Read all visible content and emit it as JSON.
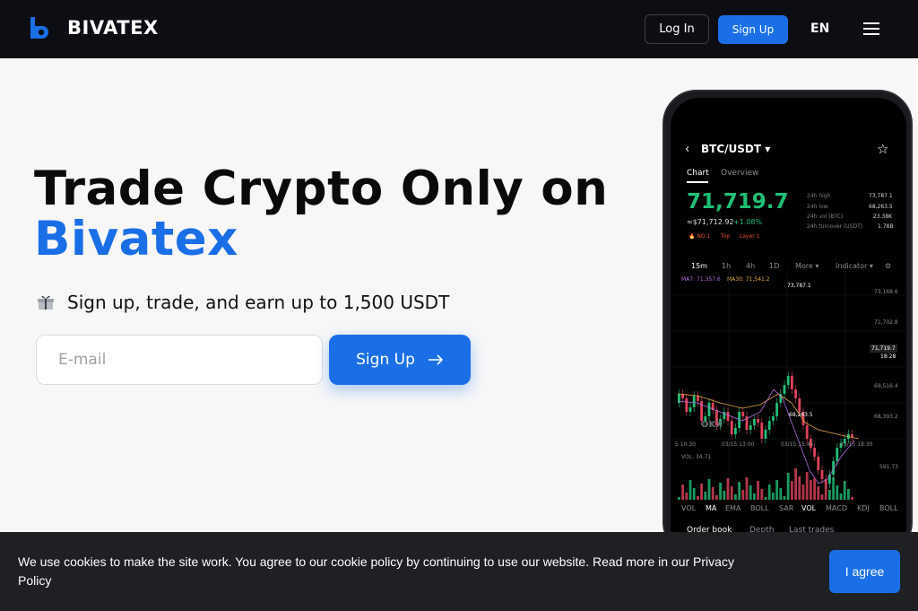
{
  "header": {
    "brand": "BIVATEX",
    "login_label": "Log In",
    "signup_label": "Sign Up",
    "language": "EN",
    "icons": [
      "bivatex-logo-icon",
      "hamburger-menu-icon"
    ]
  },
  "hero": {
    "title_line1": "Trade Crypto Only on",
    "title_line2": "Bivatex",
    "subline": "Sign up, trade, and earn up to 1,500 USDT",
    "email_placeholder": "E-mail",
    "signup_label": "Sign Up",
    "icons": [
      "gift-icon",
      "arrow-right-icon"
    ]
  },
  "phone": {
    "pair": "BTC/USDT",
    "tabs": [
      "Chart",
      "Overview"
    ],
    "price": "71,719.7",
    "sub_price": "≈$71,712.92",
    "change": "+1.08%",
    "stats": [
      {
        "label": "24h high",
        "value": "73,787.1"
      },
      {
        "label": "24h low",
        "value": "68,263.5"
      },
      {
        "label": "24h vol (BTC)",
        "value": "23.38K"
      },
      {
        "label": "24h turnover (USDT)",
        "value": "1.78B"
      }
    ],
    "tags": [
      "NO.1",
      "Top",
      "Layer 1"
    ],
    "timeframes": [
      "15m",
      "1h",
      "4h",
      "1D",
      "More ▾",
      "Indicator ▾"
    ],
    "ma7": "MA7: 71,357.6",
    "ma30": "MA30: 71,541.2",
    "high_label": "73,787.1",
    "low_label": "68,263.5",
    "right_axis": [
      "73,168.6",
      "71,702.8",
      "69,516.4",
      "68,393.2"
    ],
    "current_tag": "71,719.7",
    "current_time": "18:28",
    "dates": [
      "5 10:30",
      "03/15 13:00",
      "03/15 15:45",
      "03/15 18:30"
    ],
    "vol_label": "VOL: 34.71",
    "vol_axis": "591.73",
    "indicators": [
      "VOL",
      "MA",
      "EMA",
      "BOLL",
      "SAR",
      "VOL",
      "MACD",
      "KDJ",
      "BOLL"
    ],
    "bottom_tabs": [
      "Order book",
      "Depth",
      "Last trades"
    ],
    "watermark": "OKX"
  },
  "cookie": {
    "text": "We use cookies to make the site work. You agree to our cookie policy by continuing to use our website. Read more in our Privacy Policy",
    "agree_label": "I agree"
  },
  "colors": {
    "accent": "#1a6fe6",
    "header_bg": "#0d0e13",
    "page_bg": "#f7f7f8",
    "cookie_bg": "#1f2024",
    "up": "#1fbf75",
    "down": "#e0435b"
  }
}
